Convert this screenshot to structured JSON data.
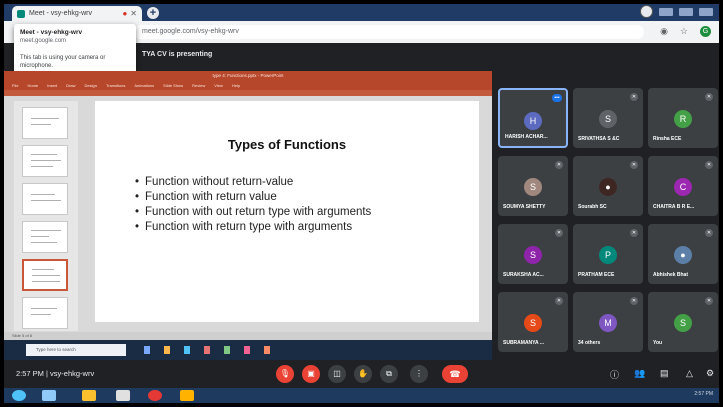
{
  "browser": {
    "tab_title": "Meet - vsy-ehkg-wrv",
    "url": "meet.google.com/vsy-ehkg-wrv",
    "popup": {
      "title": "Meet - vsy-ehkg-wrv",
      "domain": "meet.google.com",
      "message": "This tab is using your camera or microphone."
    }
  },
  "meet": {
    "presenting_banner": "TYA CV is presenting",
    "time_and_code": "2:57 PM  |  vsy-ehkg-wrv"
  },
  "slide": {
    "title": "Types of Functions",
    "bullets": [
      "Function without return-value",
      "Function with return value",
      "Function with out return type with arguments",
      "Function with return type with arguments"
    ]
  },
  "powerpoint": {
    "window_title": "type 4: Functions.pptx - PowerPoint",
    "ribbon_tabs": [
      "File",
      "Home",
      "Insert",
      "Draw",
      "Design",
      "Transitions",
      "Animations",
      "Slide Show",
      "Review",
      "View",
      "Help"
    ],
    "status": "Slide 5 of 8",
    "search_placeholder": "Type here to search"
  },
  "participants": [
    {
      "name": "HARISH ACHAR...",
      "initial": "H",
      "color": "#5c6bc0",
      "active": true
    },
    {
      "name": "SRIVATHSA S &C",
      "initial": "S",
      "color": "#5f6368"
    },
    {
      "name": "Rinsha ECE",
      "initial": "R",
      "color": "#43a047"
    },
    {
      "name": "SOUMYA SHETTY",
      "initial": "S",
      "color": "#a1887f"
    },
    {
      "name": "Sourabh SC",
      "initial": "●",
      "color": "#3e2723"
    },
    {
      "name": "CHAITRA B R E...",
      "initial": "C",
      "color": "#9c27b0"
    },
    {
      "name": "SURAKSHA AC...",
      "initial": "S",
      "color": "#8e24aa"
    },
    {
      "name": "PRATHAM ECE",
      "initial": "P",
      "color": "#00897b"
    },
    {
      "name": "Abhishek Bhat",
      "initial": "●",
      "color": "#5c7fa8"
    },
    {
      "name": "SUBRAMANYA ...",
      "initial": "S",
      "color": "#e64a19"
    },
    {
      "name": "34 others",
      "initial": "M",
      "color": "#7e57c2"
    },
    {
      "name": "You",
      "initial": "S",
      "color": "#43a047"
    }
  ],
  "taskbar": {
    "clock": "2:57 PM"
  }
}
